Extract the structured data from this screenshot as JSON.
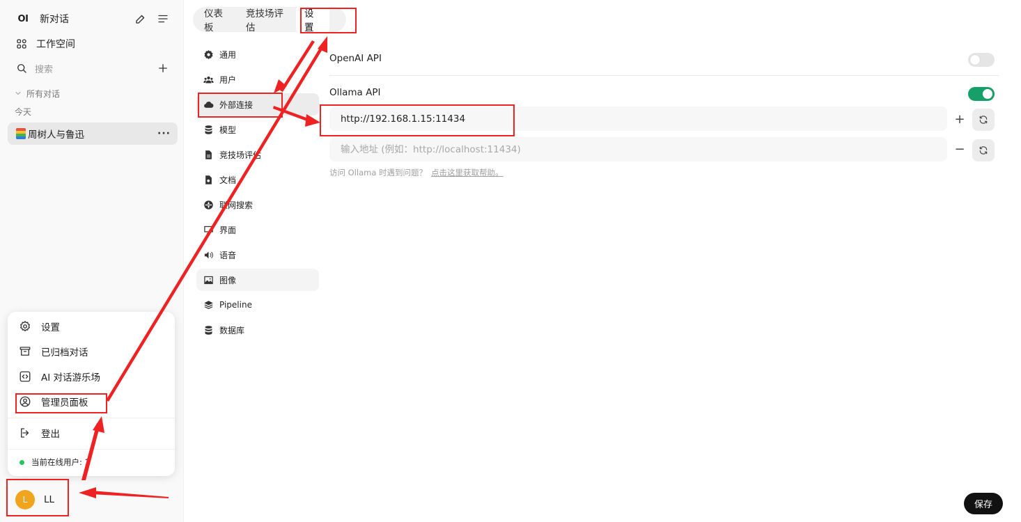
{
  "sidebar": {
    "logo": "OI",
    "new_chat_label": "新对话",
    "workspace_label": "工作空间",
    "search_placeholder": "搜索",
    "all_chats_label": "所有对话",
    "today_label": "今天",
    "chats": [
      {
        "title": "周树人与鲁迅"
      }
    ],
    "menu": {
      "settings_label": "设置",
      "archived_label": "已归档对话",
      "playground_label": "AI 对话游乐场",
      "admin_label": "管理员面板",
      "logout_label": "登出",
      "online_users_label": "当前在线用户: 1"
    },
    "user": {
      "initial": "L",
      "name": "LL"
    }
  },
  "tabs": [
    {
      "label": "仪表板"
    },
    {
      "label": "竞技场评估"
    },
    {
      "label": "设置",
      "active": true
    }
  ],
  "settings_nav": [
    {
      "label": "通用",
      "icon": "gear-icon"
    },
    {
      "label": "用户",
      "icon": "users-icon"
    },
    {
      "label": "外部连接",
      "icon": "cloud-icon",
      "active": true
    },
    {
      "label": "模型",
      "icon": "database-icon"
    },
    {
      "label": "竞技场评估",
      "icon": "document-icon"
    },
    {
      "label": "文档",
      "icon": "document-search-icon"
    },
    {
      "label": "联网搜索",
      "icon": "globe-icon"
    },
    {
      "label": "界面",
      "icon": "monitor-icon"
    },
    {
      "label": "语音",
      "icon": "speaker-icon"
    },
    {
      "label": "图像",
      "icon": "image-icon",
      "hover": true
    },
    {
      "label": "Pipeline",
      "icon": "layers-icon"
    },
    {
      "label": "数据库",
      "icon": "database-icon"
    }
  ],
  "connections": {
    "openai": {
      "title": "OpenAI API",
      "enabled": false
    },
    "ollama": {
      "title": "Ollama API",
      "enabled": true,
      "url_value": "http://192.168.1.15:11434",
      "new_url_placeholder": "输入地址 (例如：http://localhost:11434)",
      "help_text": "访问 Ollama 时遇到问题？",
      "help_link": "点击这里获取帮助。"
    }
  },
  "save_label": "保存",
  "colors": {
    "toggle_on": "#16a067",
    "annotation": "#ee2222",
    "avatar": "#f1a41e"
  }
}
